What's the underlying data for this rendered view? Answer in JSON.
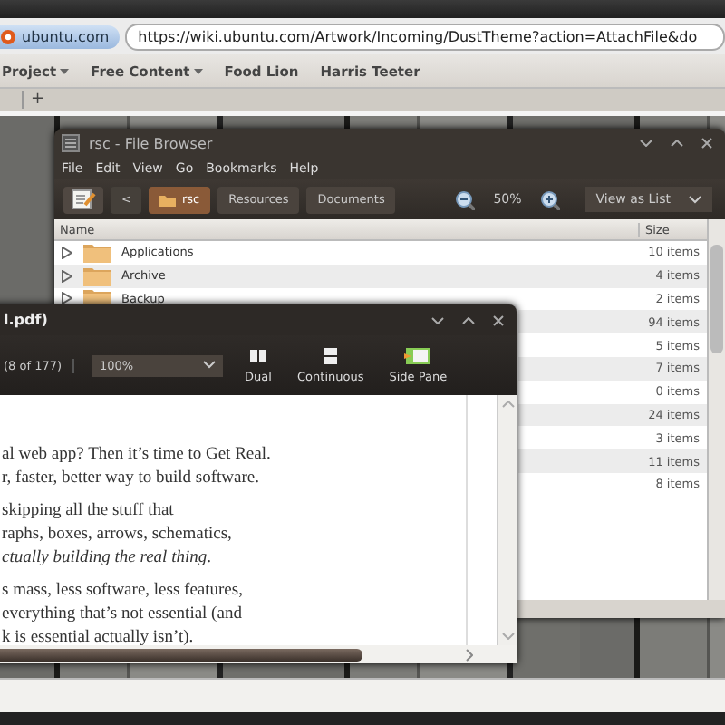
{
  "browser": {
    "site_badge": "ubuntu.com",
    "url": "https://wiki.ubuntu.com/Artwork/Incoming/DustTheme?action=AttachFile&do",
    "bookmarks": [
      {
        "label": "Project",
        "menu": true
      },
      {
        "label": "Free Content",
        "menu": true
      },
      {
        "label": "Food Lion",
        "menu": false
      },
      {
        "label": "Harris Teeter",
        "menu": false
      }
    ],
    "new_tab": "+"
  },
  "file_browser": {
    "title": "rsc - File Browser",
    "menu": [
      "File",
      "Edit",
      "View",
      "Go",
      "Bookmarks",
      "Help"
    ],
    "back": "<",
    "path": [
      {
        "label": "rsc",
        "selected": true
      },
      {
        "label": "Resources",
        "selected": false
      },
      {
        "label": "Documents",
        "selected": false
      }
    ],
    "zoom": "50%",
    "view": "View as List",
    "columns": [
      "Name",
      "Size"
    ],
    "rows": [
      {
        "name": "Applications",
        "size": "10 items"
      },
      {
        "name": "Archive",
        "size": "4 items"
      },
      {
        "name": "Backup",
        "size": "2 items"
      },
      {
        "size": "94 items"
      },
      {
        "size": "5 items"
      },
      {
        "size": "7 items"
      },
      {
        "size": "0 items"
      },
      {
        "size": "24 items"
      },
      {
        "size": "3 items"
      },
      {
        "size": "11 items"
      },
      {
        "size": "8 items"
      }
    ]
  },
  "pdf_viewer": {
    "title": "l.pdf)",
    "page": "(8 of 177)",
    "zoom": "100%",
    "tools": [
      {
        "kind": "dual",
        "label": "Dual"
      },
      {
        "kind": "continuous",
        "label": "Continuous"
      },
      {
        "kind": "sidepane",
        "label": "Side Pane"
      }
    ],
    "paragraphs": [
      [
        "al web app? Then it’s time to Get Real.",
        "r, faster, better way to build software."
      ],
      [
        "skipping all the stuff that",
        "raphs, boxes, arrows, schematics,",
        "*ctually building the real thing*."
      ],
      [
        "s mass, less software, less features,",
        "everything that’s not essential (and",
        "k is essential actually isn’t)."
      ]
    ]
  }
}
